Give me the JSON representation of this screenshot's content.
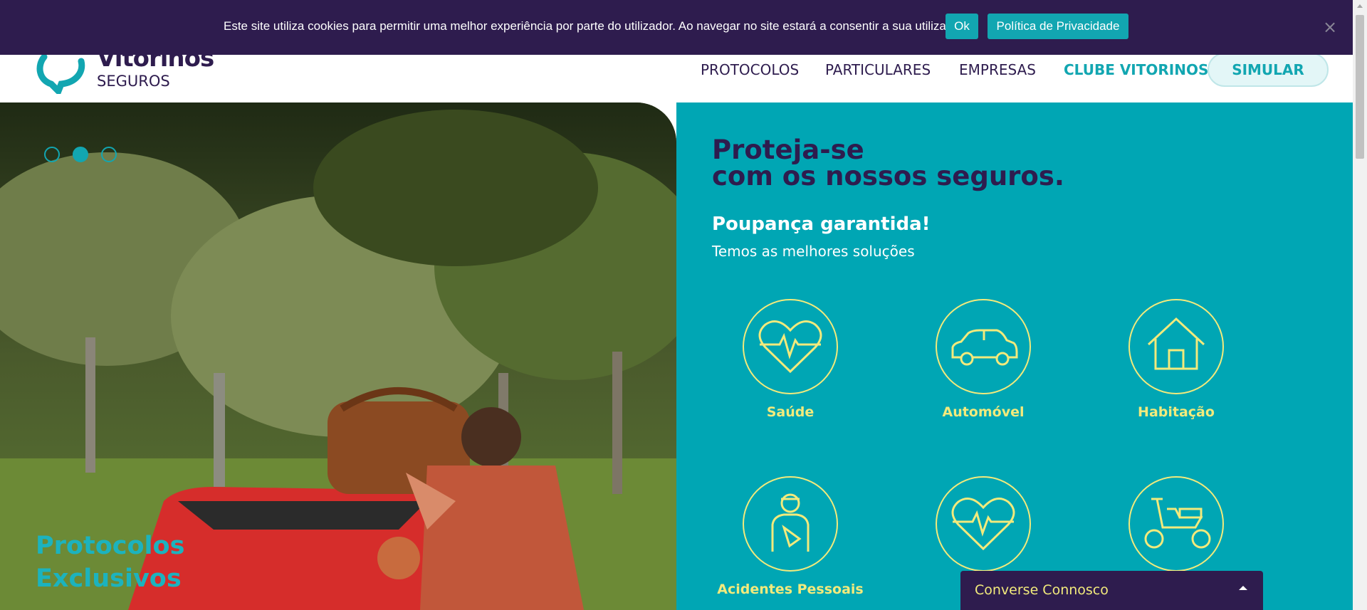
{
  "cookie_bar": {
    "message": "Este site utiliza cookies para permitir uma melhor experiência por parte do utilizador. Ao navegar no site estará a consentir a sua utilização.",
    "ok_label": "Ok",
    "policy_label": "Política de Privacidade",
    "close_glyph": "×"
  },
  "header": {
    "logo_name": "Vitorinos",
    "logo_sub": "SEGUROS",
    "nav": [
      "PROTOCOLOS",
      "PARTICULARES",
      "EMPRESAS",
      "CLUBE VITORINOS"
    ],
    "simular_label": "SIMULAR"
  },
  "hero": {
    "caption_line1": "Protocolos",
    "caption_line2": "Exclusivos",
    "slides_total": 3,
    "active_slide": 2
  },
  "panel": {
    "title_line1": "Proteja-se",
    "title_line2": "com os nossos seguros.",
    "subtitle": "Poupança garantida!",
    "subtitle2": "Temos as melhores soluções",
    "items": [
      {
        "label": "Saúde",
        "icon": "heart-pulse-icon"
      },
      {
        "label": "Automóvel",
        "icon": "car-icon"
      },
      {
        "label": "Habitação",
        "icon": "house-icon"
      },
      {
        "label": "Acidentes Pessoais",
        "icon": "injured-person-icon"
      },
      {
        "label": "",
        "icon": "heart-pulse-icon"
      },
      {
        "label": "",
        "icon": "scooter-icon"
      }
    ]
  },
  "chat": {
    "label": "Converse Connosco"
  },
  "colors": {
    "brand_purple": "#2e1c4e",
    "brand_teal": "#12a6b1",
    "panel_teal": "#00a6b4",
    "icon_yellow": "#f2ea7c"
  }
}
